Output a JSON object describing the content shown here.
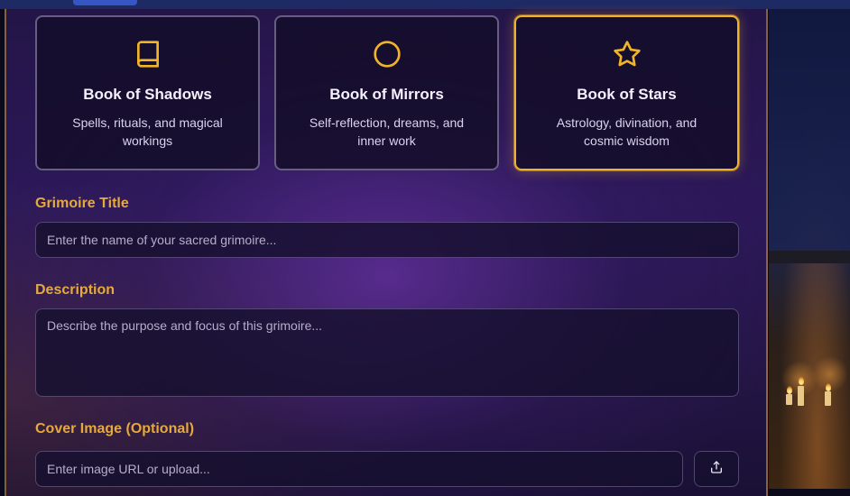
{
  "grimoire_types": [
    {
      "title": "Book of Shadows",
      "description": "Spells, rituals, and magical workings",
      "icon": "book-icon",
      "selected": false
    },
    {
      "title": "Book of Mirrors",
      "description": "Self-reflection, dreams, and inner work",
      "icon": "circle-icon",
      "selected": false
    },
    {
      "title": "Book of Stars",
      "description": "Astrology, divination, and cosmic wisdom",
      "icon": "star-icon",
      "selected": true
    }
  ],
  "form": {
    "title_label": "Grimoire Title",
    "title_placeholder": "Enter the name of your sacred grimoire...",
    "description_label": "Description",
    "description_placeholder": "Describe the purpose and focus of this grimoire...",
    "cover_label": "Cover Image (Optional)",
    "cover_placeholder": "Enter image URL or upload..."
  },
  "colors": {
    "accent_gold": "#f0b429",
    "label_gold": "#e6a93a",
    "panel_purple": "#2b1858"
  }
}
